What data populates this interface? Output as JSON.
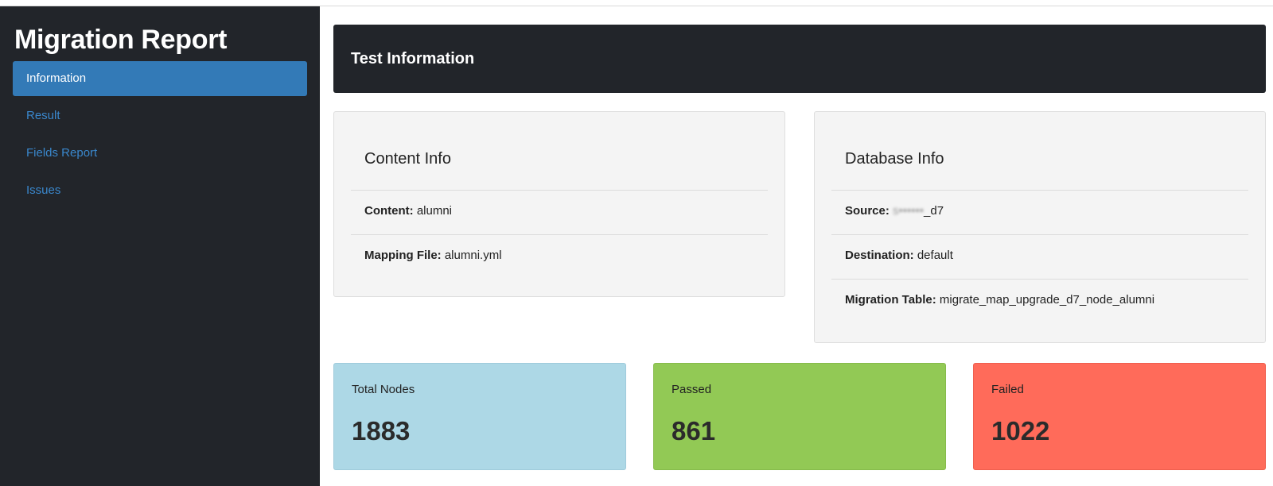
{
  "sidebar": {
    "title": "Migration Report",
    "items": [
      {
        "label": "Information",
        "active": true
      },
      {
        "label": "Result",
        "active": false
      },
      {
        "label": "Fields Report",
        "active": false
      },
      {
        "label": "Issues",
        "active": false
      }
    ]
  },
  "header": {
    "title": "Test Information"
  },
  "content_info": {
    "title": "Content Info",
    "content_label": "Content:",
    "content_value": "alumni",
    "mapping_label": "Mapping File:",
    "mapping_value": "alumni.yml"
  },
  "database_info": {
    "title": "Database Info",
    "source_label": "Source:",
    "source_value_redacted": "s••••••",
    "source_value_suffix": "_d7",
    "destination_label": "Destination:",
    "destination_value": "default",
    "table_label": "Migration Table:",
    "table_value": "migrate_map_upgrade_d7_node_alumni"
  },
  "stats": {
    "total": {
      "label": "Total Nodes",
      "value": "1883",
      "color": "#add8e6"
    },
    "passed": {
      "label": "Passed",
      "value": "861",
      "color": "#92c955"
    },
    "failed": {
      "label": "Failed",
      "value": "1022",
      "color": "#ff6b5a"
    }
  },
  "colors": {
    "sidebar_bg": "#22252a",
    "nav_active": "#337ab7",
    "nav_link": "#3a87cc"
  }
}
